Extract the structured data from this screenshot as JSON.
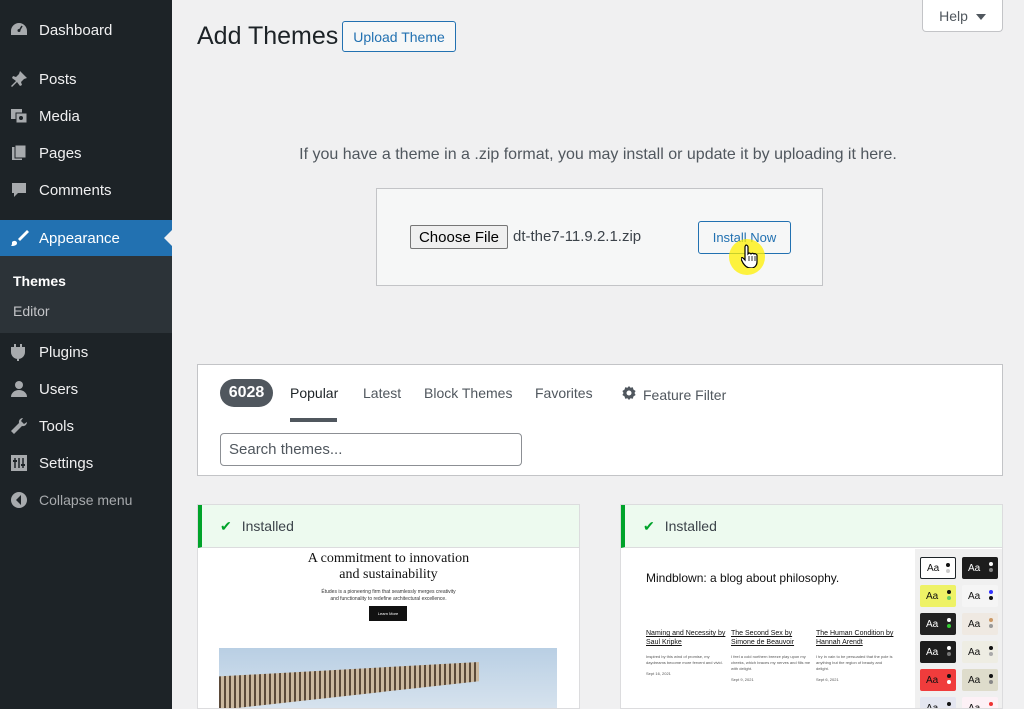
{
  "sidebar": {
    "items": [
      {
        "label": "Dashboard",
        "icon": "dashboard-icon"
      },
      {
        "label": "Posts",
        "icon": "pin-icon"
      },
      {
        "label": "Media",
        "icon": "media-icon"
      },
      {
        "label": "Pages",
        "icon": "pages-icon"
      },
      {
        "label": "Comments",
        "icon": "comment-icon"
      },
      {
        "label": "Appearance",
        "icon": "brush-icon",
        "active": true
      },
      {
        "label": "Plugins",
        "icon": "plug-icon"
      },
      {
        "label": "Users",
        "icon": "user-icon"
      },
      {
        "label": "Tools",
        "icon": "wrench-icon"
      },
      {
        "label": "Settings",
        "icon": "sliders-icon"
      }
    ],
    "submenu": [
      {
        "label": "Themes",
        "current": true
      },
      {
        "label": "Editor"
      }
    ],
    "collapse_label": "Collapse menu"
  },
  "header": {
    "title": "Add Themes",
    "upload_button": "Upload Theme",
    "help_label": "Help"
  },
  "upload": {
    "description": "If you have a theme in a .zip format, you may install or update it by uploading it here.",
    "choose_file_label": "Choose File",
    "file_name": "dt-the7-11.9.2.1.zip",
    "install_button": "Install Now"
  },
  "filter": {
    "count": "6028",
    "tabs": [
      "Popular",
      "Latest",
      "Block Themes",
      "Favorites"
    ],
    "current_tab": "Popular",
    "feature_filter_label": "Feature Filter",
    "search_placeholder": "Search themes..."
  },
  "themes": [
    {
      "notice": "Installed",
      "preview": {
        "title_line1": "A commitment to innovation",
        "title_line2": "and sustainability",
        "body_line1": "Études is a pioneering firm that seamlessly merges creativity",
        "body_line2": "and functionality to redefine architectural excellence.",
        "button": "Learn More"
      }
    },
    {
      "notice": "Installed",
      "preview": {
        "heading": "Mindblown: a blog about philosophy.",
        "posts": [
          {
            "title": "Naming and Necessity by Saul Kripke",
            "text": "Inspired by this wind of promise, my daydreams become more fervent and vivid.",
            "date": "Sept 16, 2021"
          },
          {
            "title": "The Second Sex by Simone de Beauvoir",
            "text": "I feel a cold northern breeze play upon my cheeks, which braces my nerves and fills me with delight.",
            "date": "Sept 9, 2021"
          },
          {
            "title": "The Human Condition by Hannah Arendt",
            "text": "I try in vain to be persuaded that the pole is anything but the region of beauty and delight.",
            "date": "Sept 6, 2021"
          }
        ],
        "swatch_label": "Aa"
      }
    }
  ],
  "colors": {
    "admin_bar": "#1d2327",
    "accent": "#2271b1",
    "installed": "#00a32a"
  }
}
